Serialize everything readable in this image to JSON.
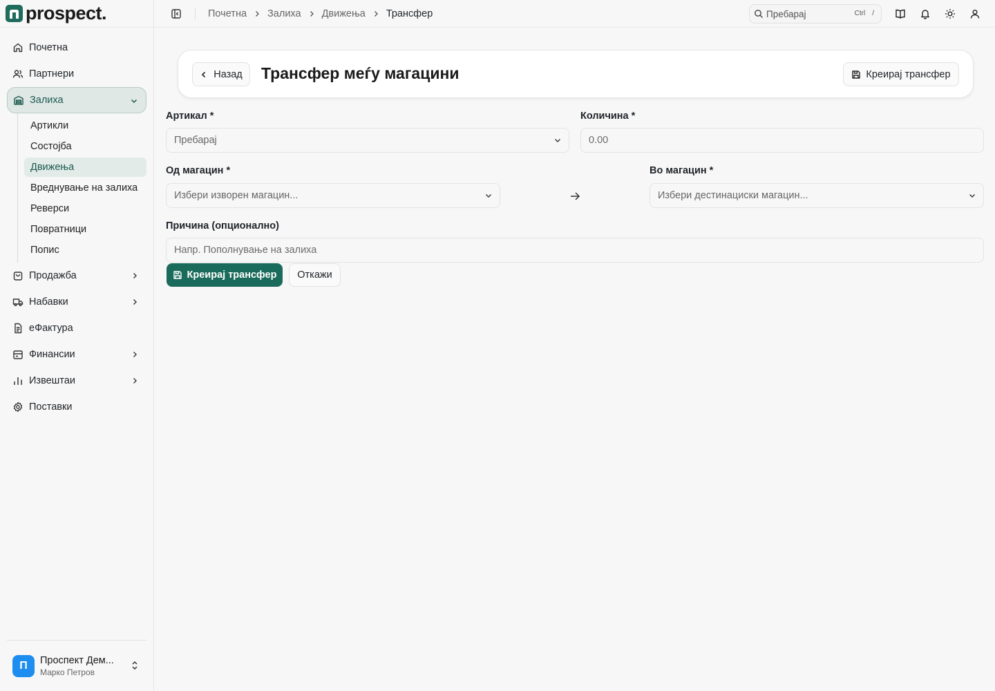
{
  "app": {
    "logo_text": "prospect."
  },
  "sidebar": {
    "items": [
      {
        "label": "Почетна",
        "icon": "home-icon"
      },
      {
        "label": "Партнери",
        "icon": "users-icon"
      },
      {
        "label": "Залиха",
        "icon": "warehouse-icon",
        "active": true,
        "expanded": true
      },
      {
        "label": "Продажба",
        "icon": "shopping-bag-icon",
        "has_children": true
      },
      {
        "label": "Набавки",
        "icon": "truck-icon",
        "has_children": true
      },
      {
        "label": "еФактура",
        "icon": "document-icon"
      },
      {
        "label": "Финансии",
        "icon": "wallet-icon",
        "has_children": true
      },
      {
        "label": "Извештаи",
        "icon": "bar-chart-icon",
        "has_children": true
      },
      {
        "label": "Поставки",
        "icon": "gear-icon"
      }
    ],
    "submenu": [
      {
        "label": "Артикли"
      },
      {
        "label": "Состојба"
      },
      {
        "label": "Движења",
        "active": true
      },
      {
        "label": "Вреднување на залиха"
      },
      {
        "label": "Реверси"
      },
      {
        "label": "Повратници"
      },
      {
        "label": "Попис"
      }
    ],
    "account": {
      "initial": "П",
      "name": "Проспект Дем...",
      "user": "Марко Петров"
    }
  },
  "topbar": {
    "breadcrumbs": [
      "Почетна",
      "Залиха",
      "Движења",
      "Трансфер"
    ],
    "search_placeholder": "Пребарај",
    "shortcut_ctrl": "Ctrl",
    "shortcut_key": "/"
  },
  "header": {
    "back_label": "Назад",
    "title": "Трансфер меѓу магацини",
    "create_label": "Креирај трансфер"
  },
  "form": {
    "article": {
      "label": "Артикал *",
      "placeholder": "Пребарај"
    },
    "quantity": {
      "label": "Количина *",
      "placeholder": "0.00"
    },
    "from_warehouse": {
      "label": "Од магацин *",
      "placeholder": "Избери изворен магацин..."
    },
    "to_warehouse": {
      "label": "Во магацин *",
      "placeholder": "Избери дестинациски магацин..."
    },
    "reason": {
      "label": "Причина (опционално)",
      "placeholder": "Напр. Пополнување на залиха"
    },
    "submit_label": "Креирај трансфер",
    "cancel_label": "Откажи"
  },
  "colors": {
    "brand": "#1a6b5b",
    "avatar": "#1d8df0"
  }
}
